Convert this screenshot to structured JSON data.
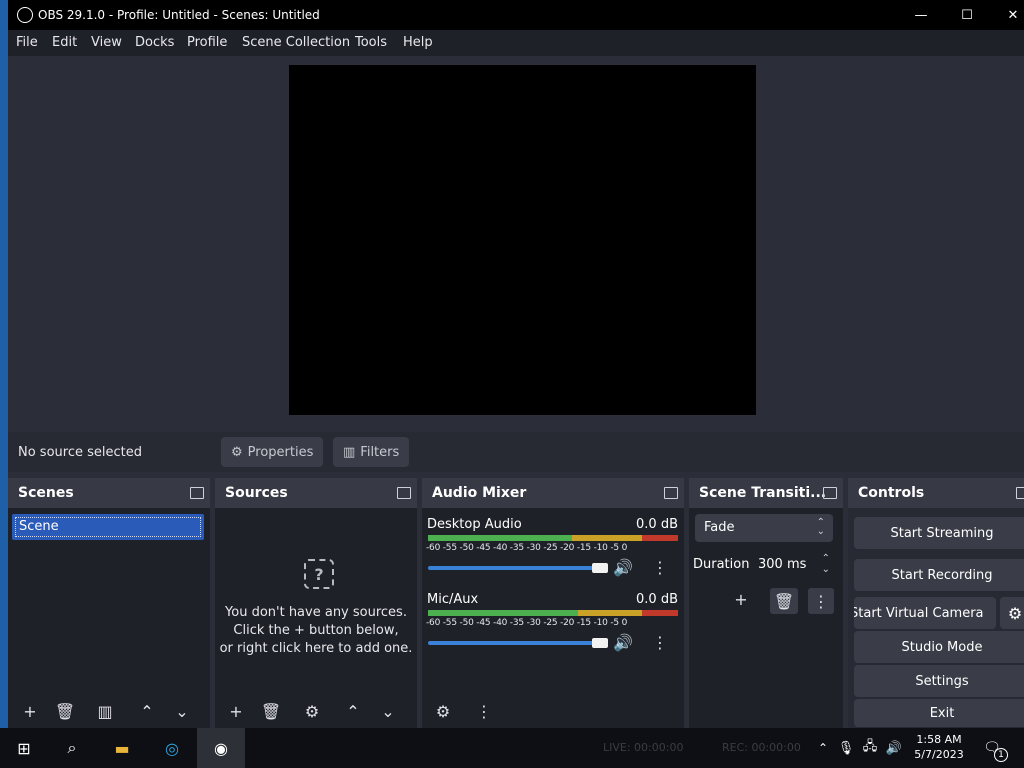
{
  "window": {
    "title": "OBS 29.1.0 - Profile: Untitled - Scenes: Untitled",
    "minimize_glyph": "—",
    "maximize_glyph": "☐",
    "close_glyph": "✕"
  },
  "menu": [
    "File",
    "Edit",
    "View",
    "Docks",
    "Profile",
    "Scene Collection",
    "Tools",
    "Help"
  ],
  "source_bar": {
    "status": "No source selected",
    "properties_label": "Properties",
    "filters_label": "Filters"
  },
  "scenes": {
    "title": "Scenes",
    "items": [
      "Scene"
    ]
  },
  "sources": {
    "title": "Sources",
    "empty_line1": "You don't have any sources.",
    "empty_line2": "Click the + button below,",
    "empty_line3": "or right click here to add one."
  },
  "audio_mixer": {
    "title": "Audio Mixer",
    "tick_labels": "-60 -55 -50 -45 -40 -35 -30 -25 -20 -15 -10 -5 0",
    "channels": [
      {
        "name": "Desktop Audio",
        "level": "0.0 dB",
        "volume_fraction": 1.0
      },
      {
        "name": "Mic/Aux",
        "level": "0.0 dB",
        "volume_fraction": 1.0
      }
    ]
  },
  "transitions": {
    "title": "Scene Transiti...",
    "selected": "Fade",
    "duration_label": "Duration",
    "duration_value": "300 ms"
  },
  "controls": {
    "title": "Controls",
    "start_streaming": "Start Streaming",
    "start_recording": "Start Recording",
    "start_virtual_camera": "Start Virtual Camera",
    "studio_mode": "Studio Mode",
    "settings": "Settings",
    "exit": "Exit"
  },
  "taskbar": {
    "live": "LIVE: 00:00:00",
    "rec": "REC: 00:00:00",
    "time": "1:58 AM",
    "date": "5/7/2023",
    "notification_count": "1"
  },
  "colors": {
    "accent": "#2a5bb9",
    "meter_green": "#4caf50",
    "meter_yellow": "#c9a227",
    "meter_red": "#c0392b"
  }
}
